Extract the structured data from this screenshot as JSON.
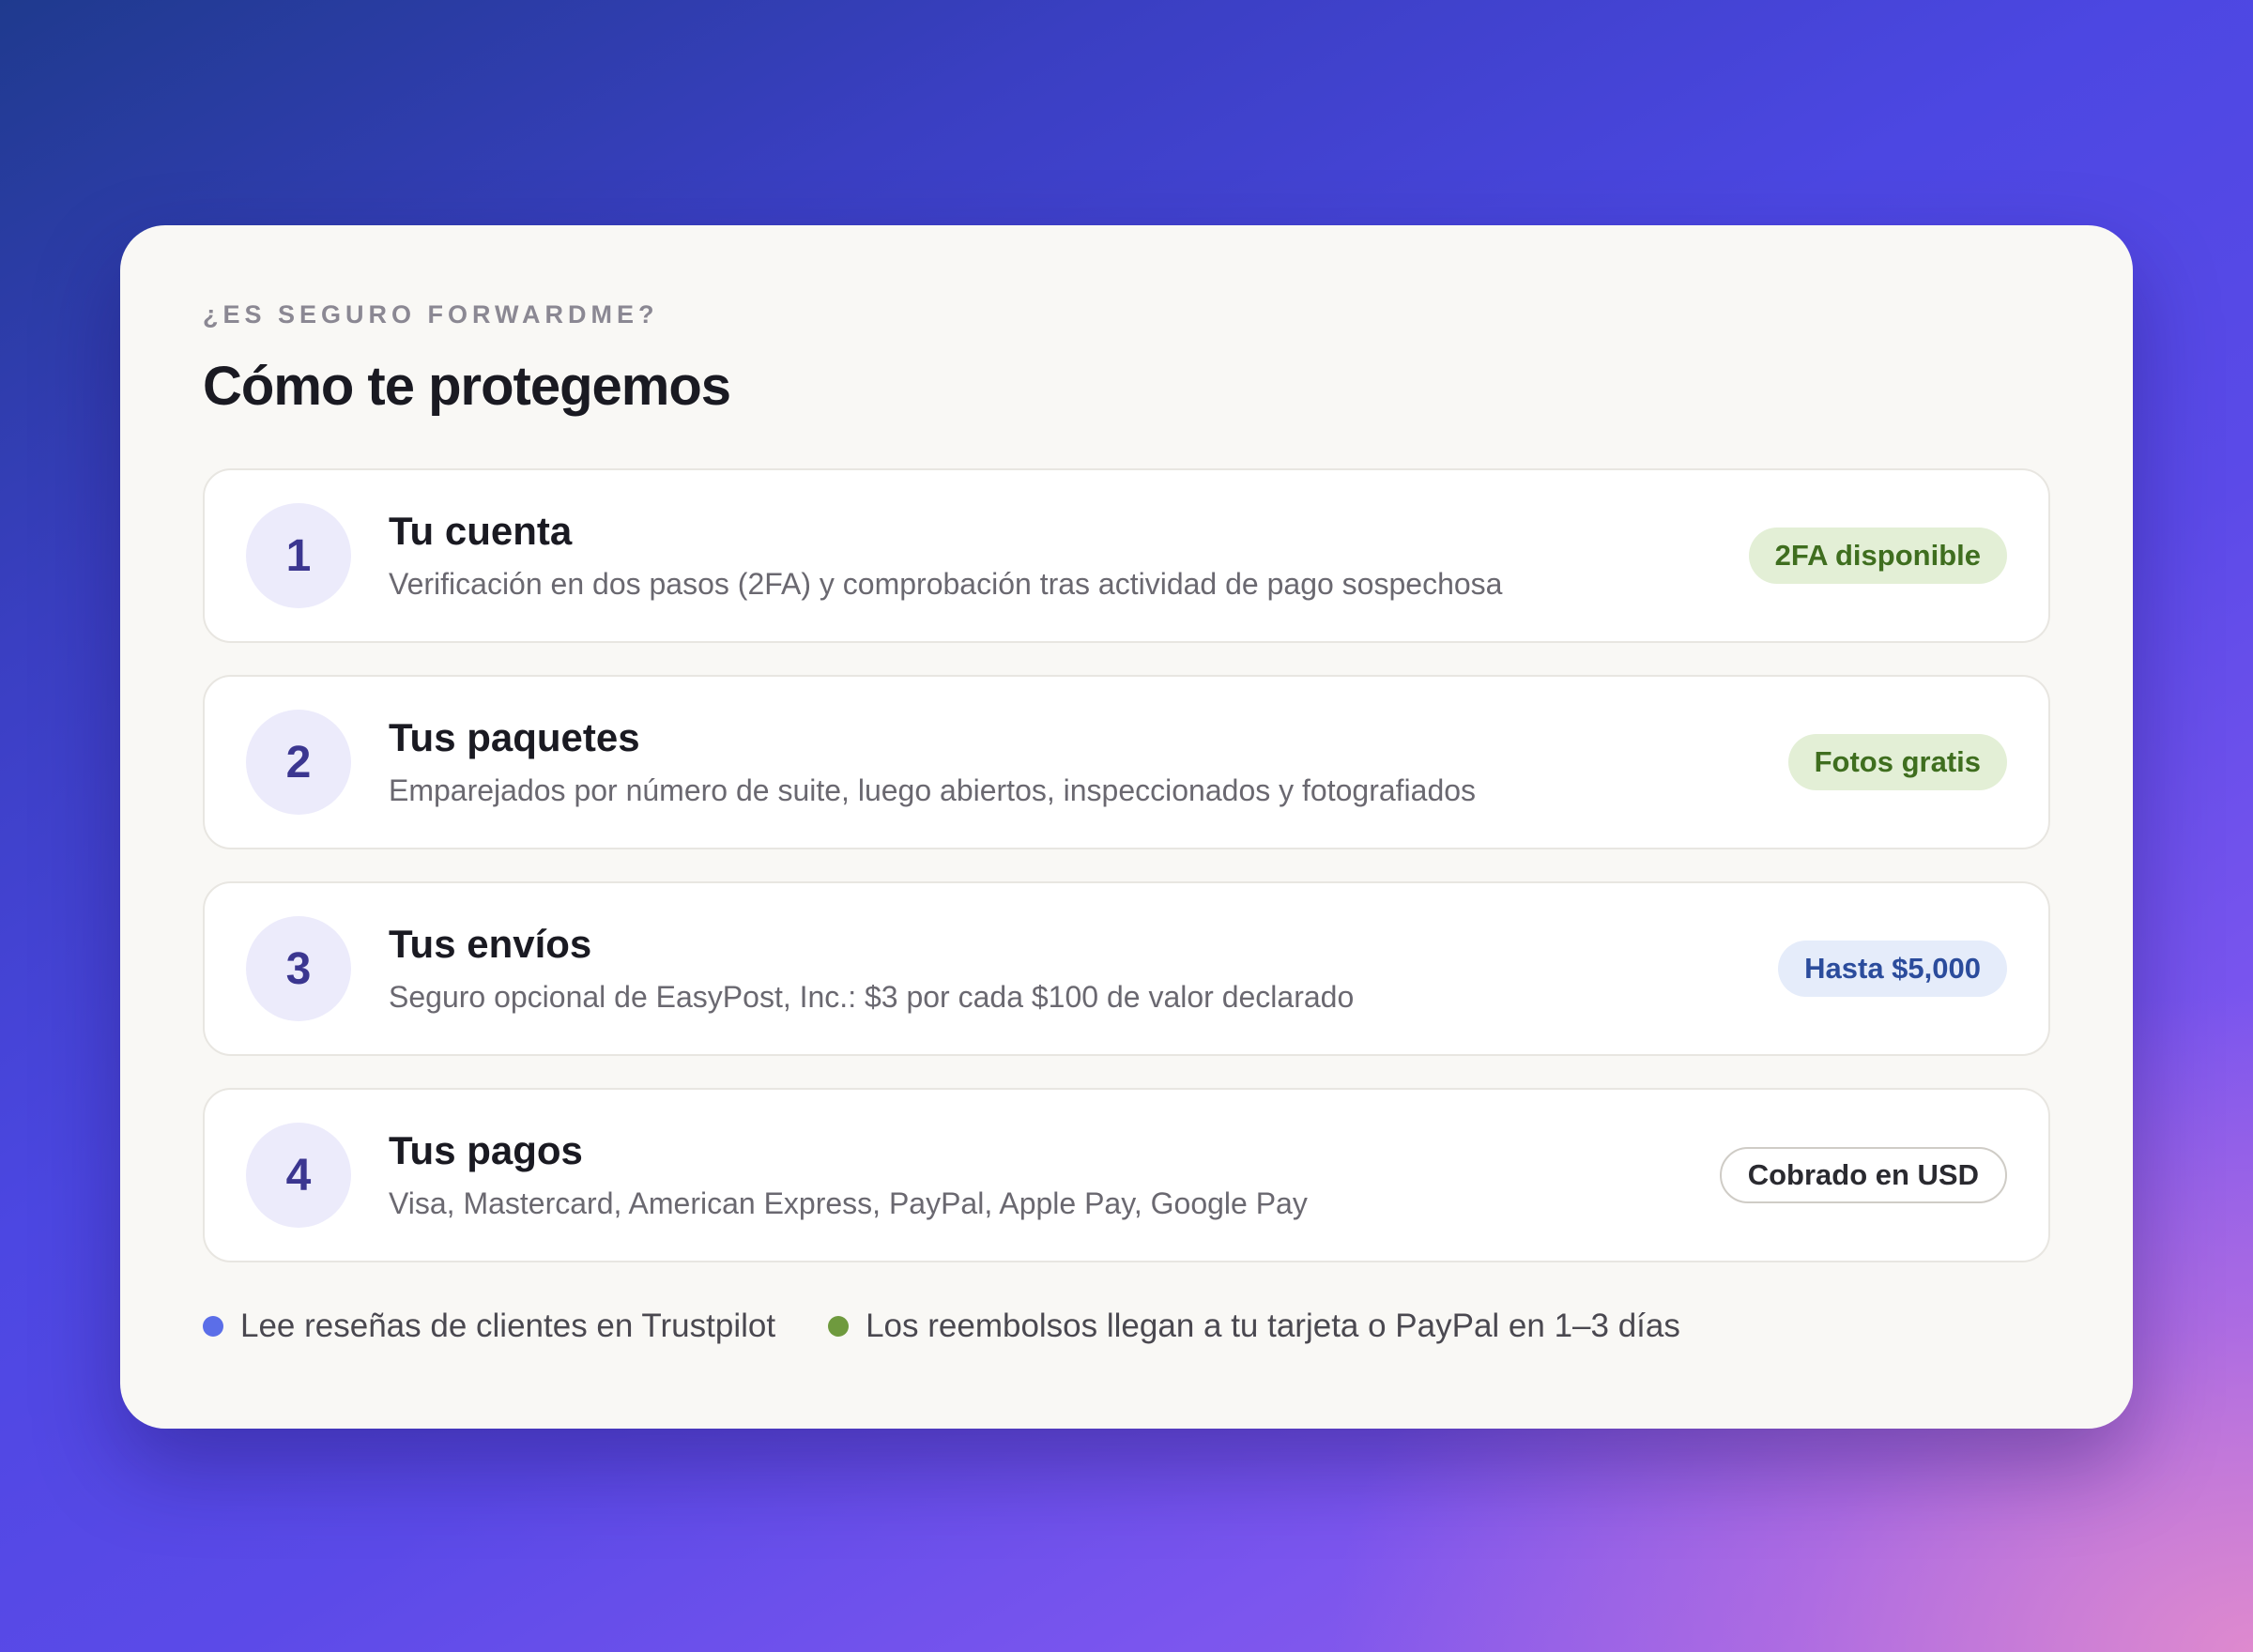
{
  "header": {
    "eyebrow": "¿ES SEGURO FORWARDME?",
    "title": "Cómo te protegemos"
  },
  "steps": [
    {
      "number": "1",
      "title": "Tu cuenta",
      "description": "Verificación en dos pasos (2FA) y comprobación tras actividad de pago sospechosa",
      "badge": "2FA disponible",
      "badge_style": "green"
    },
    {
      "number": "2",
      "title": "Tus paquetes",
      "description": "Emparejados por número de suite, luego abiertos, inspeccionados y fotografiados",
      "badge": "Fotos gratis",
      "badge_style": "green"
    },
    {
      "number": "3",
      "title": "Tus envíos",
      "description": "Seguro opcional de EasyPost, Inc.: $3 por cada $100 de valor declarado",
      "badge": "Hasta $5,000",
      "badge_style": "blue"
    },
    {
      "number": "4",
      "title": "Tus pagos",
      "description": "Visa, Mastercard, American Express, PayPal, Apple Pay, Google Pay",
      "badge": "Cobrado en USD",
      "badge_style": "outline"
    }
  ],
  "footer": [
    {
      "text": "Lee reseñas de clientes en Trustpilot",
      "dot_color": "#5b6ee8"
    },
    {
      "text": "Los reembolsos llegan a tu tarjeta o PayPal en 1–3 días",
      "dot_color": "#6f9a3e"
    }
  ],
  "colors": {
    "accent": "#3b3690",
    "badge_green_text": "#3f6e1f",
    "badge_blue_text": "#2b4c9c"
  }
}
